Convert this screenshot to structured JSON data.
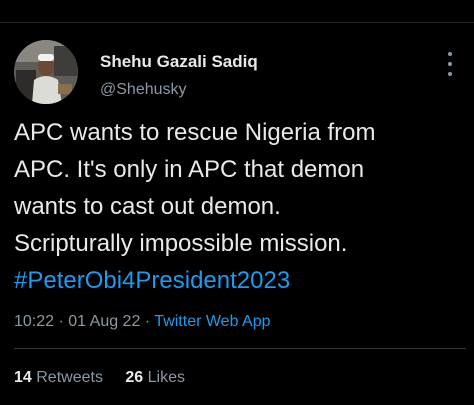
{
  "author": {
    "display_name": "Shehu Gazali Sadiq",
    "handle": "@Shehusky"
  },
  "tweet": {
    "lines": [
      "APC wants to rescue Nigeria from",
      "APC. It's only in APC that demon",
      "wants to cast out demon.",
      "Scripturally impossible mission."
    ],
    "hashtag": "#PeterObi4President2023"
  },
  "meta": {
    "time": "10:22",
    "separator": "·",
    "date": "01 Aug 22",
    "source": "Twitter Web App"
  },
  "stats": {
    "retweets_count": "14",
    "retweets_label": "Retweets",
    "likes_count": "26",
    "likes_label": "Likes"
  },
  "icons": {
    "more": "more-vertical-icon",
    "avatar": "avatar-photo"
  },
  "colors": {
    "background": "#000000",
    "text": "#e7e9ea",
    "secondary": "#8b98a5",
    "link": "#1d9bf0"
  }
}
